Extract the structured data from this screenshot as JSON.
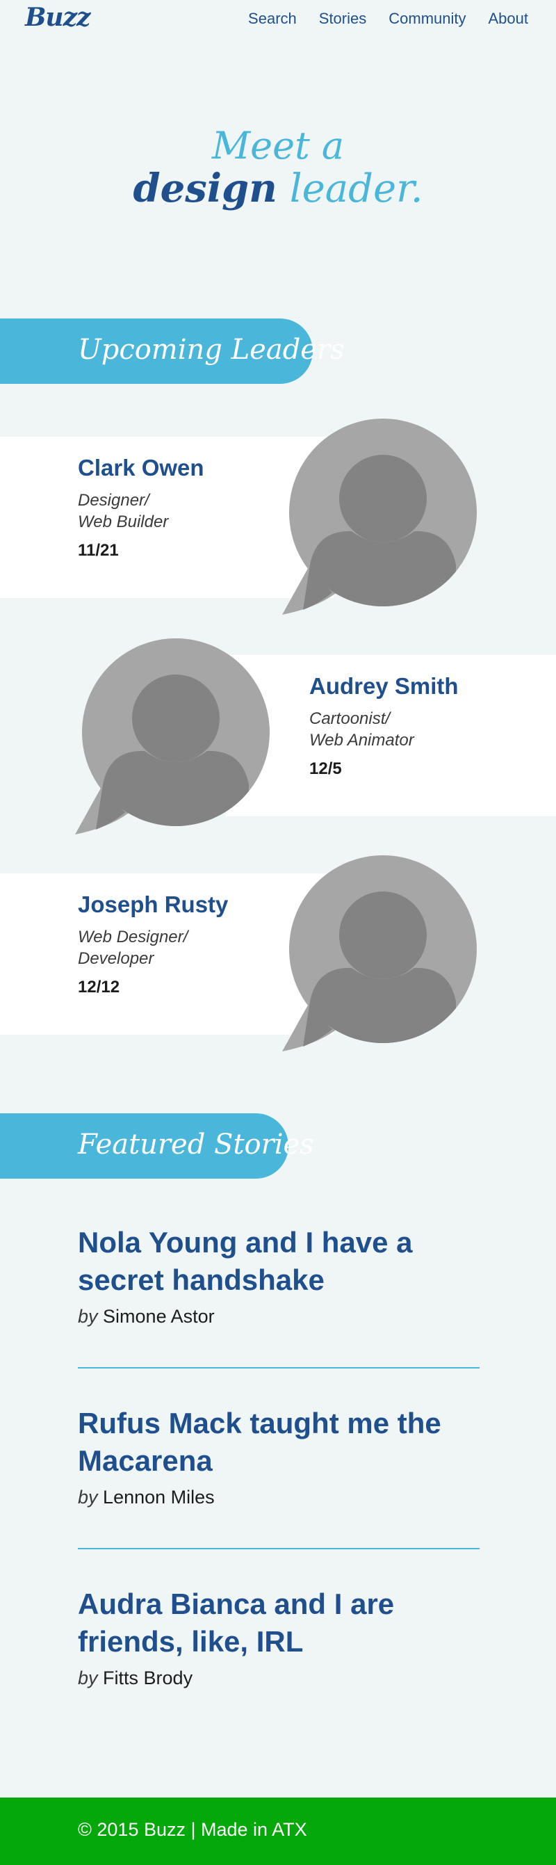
{
  "header": {
    "logo": "Buzz",
    "nav": [
      "Search",
      "Stories",
      "Community",
      "About"
    ]
  },
  "hero": {
    "line1": "Meet a",
    "line2_word1": "design",
    "line2_word2": "leader."
  },
  "upcoming": {
    "heading": "Upcoming Leaders",
    "leaders": [
      {
        "name": "Clark Owen",
        "role_line1": "Designer/",
        "role_line2": "Web Builder",
        "date": "11/21"
      },
      {
        "name": "Audrey Smith",
        "role_line1": "Cartoonist/",
        "role_line2": "Web Animator",
        "date": "12/5"
      },
      {
        "name": "Joseph Rusty",
        "role_line1": "Web Designer/",
        "role_line2": "Developer",
        "date": "12/12"
      }
    ]
  },
  "featured": {
    "heading": "Featured Stories",
    "stories": [
      {
        "title_line1": "Nola Young and I have a",
        "title_line2": "secret handshake",
        "by": "by",
        "author": "Simone Astor"
      },
      {
        "title_line1": "Rufus Mack taught me the",
        "title_line2": "Macarena",
        "by": "by",
        "author": "Lennon Miles"
      },
      {
        "title_line1": "Audra Bianca and I are",
        "title_line2": "friends, like, IRL",
        "by": "by",
        "author": "Fitts Brody"
      }
    ]
  },
  "footer": {
    "text": "© 2015 Buzz | Made in ATX"
  },
  "colors": {
    "brand_dark": "#1f4f8c",
    "brand_light": "#4ab6da",
    "footer_green": "#04a80a",
    "page_bg": "#f0f6f6"
  },
  "icons": {
    "avatar": "user-avatar-speech-bubble-icon"
  }
}
